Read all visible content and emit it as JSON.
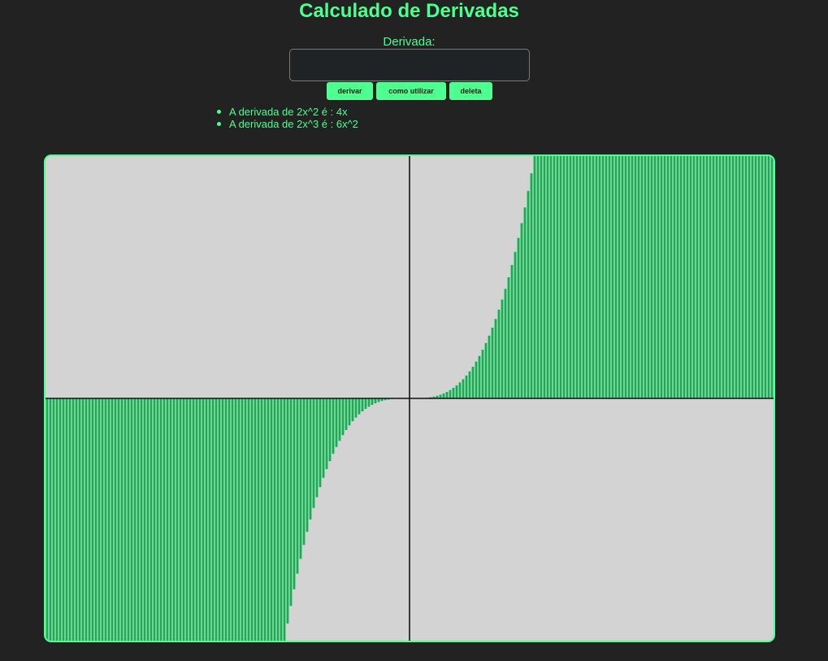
{
  "page": {
    "title": "Calculado de Derivadas",
    "input_label": "Derivada:",
    "input_value": "",
    "buttons": {
      "derivar": "derivar",
      "como_utilizar": "como utilizar",
      "deleta": "deleta"
    },
    "results": [
      "A derivada de 2x^2 é : 4x",
      "A derivada de 2x^3 é : 6x^2"
    ]
  },
  "colors": {
    "background": "#222222",
    "accent": "#4cff8f",
    "bar": "#0fb14f",
    "plot_background": "#d3d3d3",
    "axis": "#111111"
  },
  "chart_data": {
    "type": "bar",
    "function": "6x^2",
    "x_range": [
      -15,
      15
    ],
    "y_range": [
      -15,
      15
    ],
    "grid": false,
    "legend": "none",
    "title": "",
    "xlabel": "",
    "ylabel": ""
  }
}
